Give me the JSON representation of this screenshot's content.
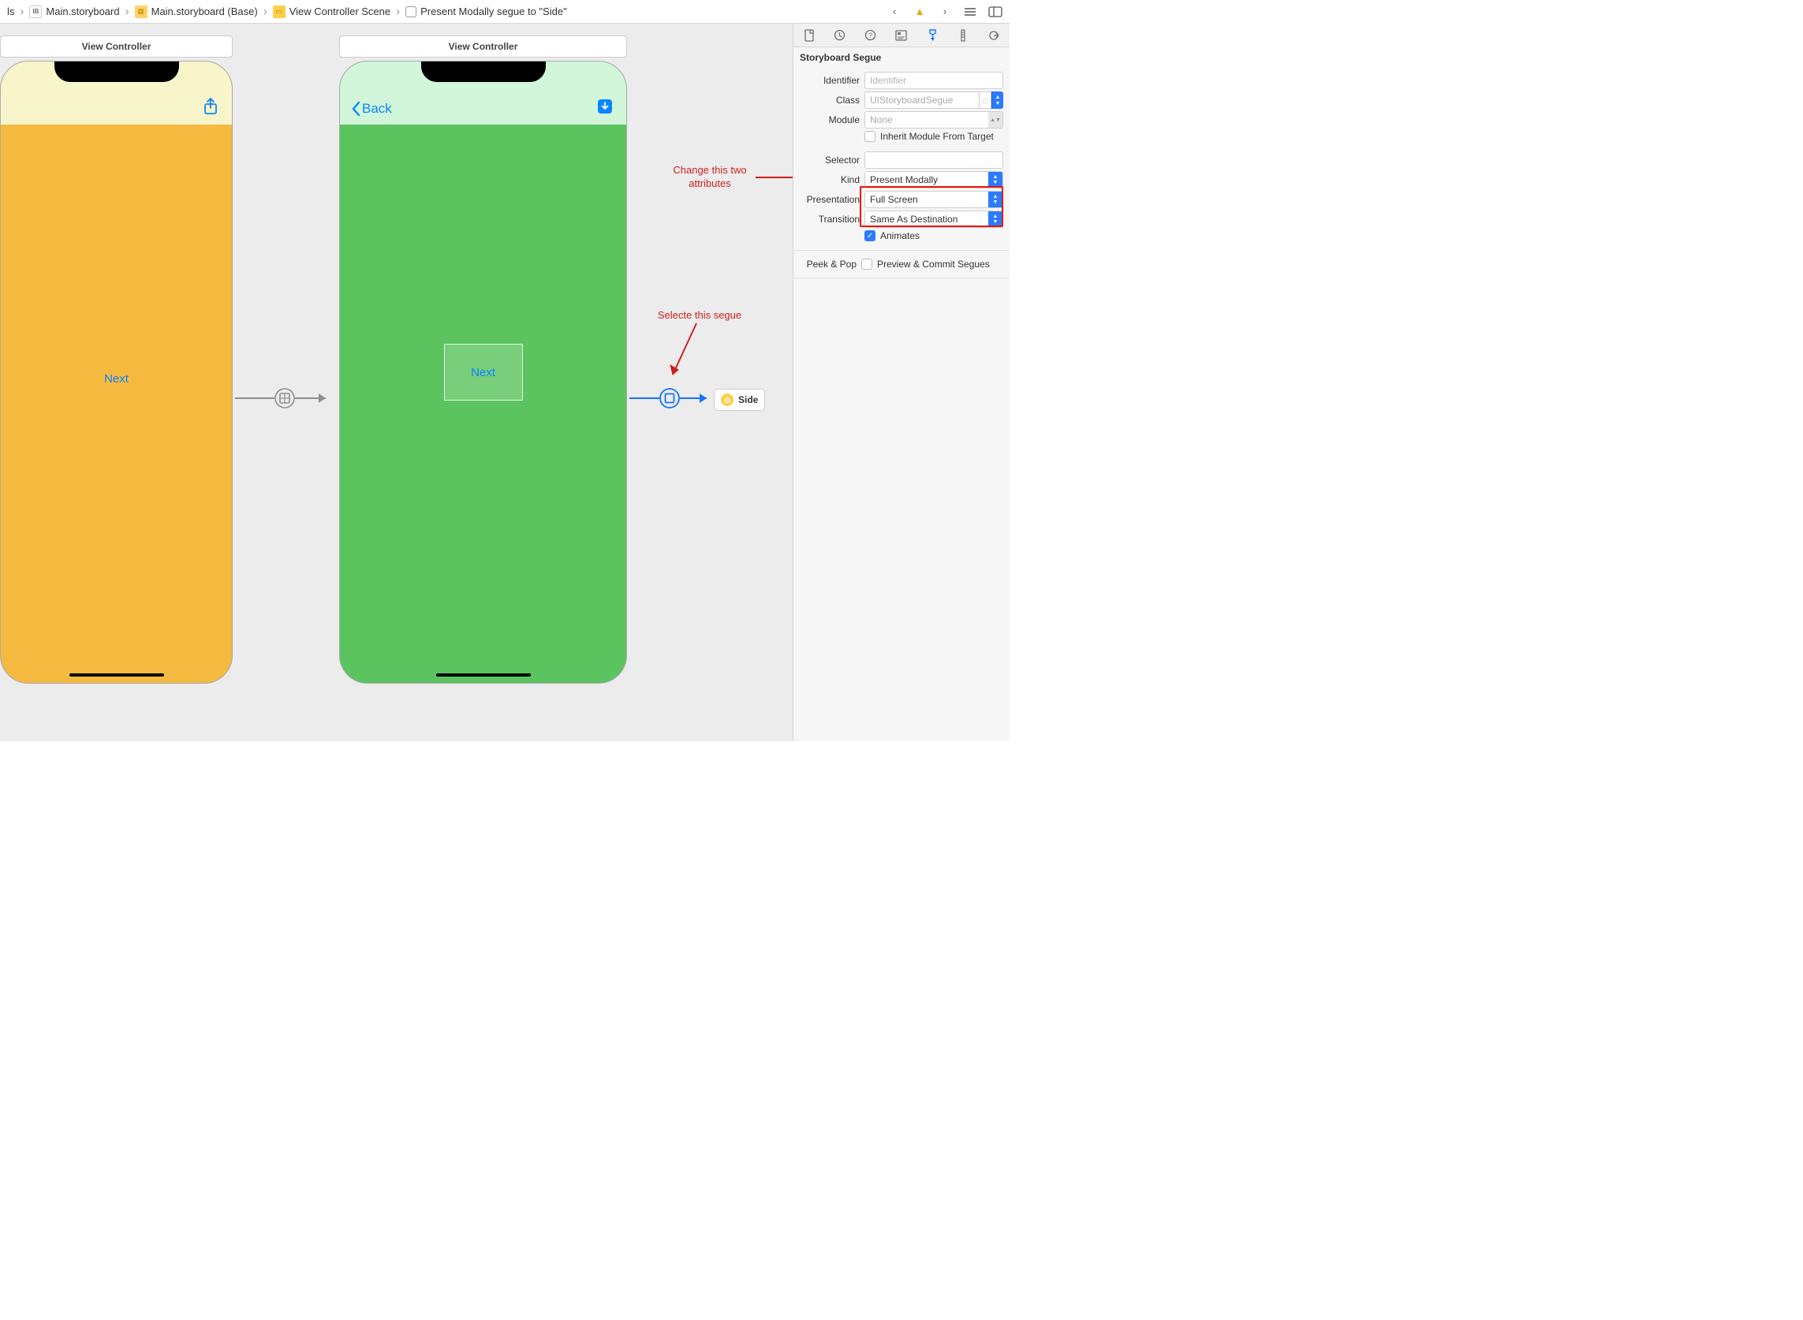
{
  "jumpbar": {
    "crumbs": [
      {
        "icon": "txt",
        "label": "ls"
      },
      {
        "icon": "file",
        "label": "Main.storyboard"
      },
      {
        "icon": "sb",
        "label": "Main.storyboard (Base)"
      },
      {
        "icon": "scene",
        "label": "View Controller Scene"
      },
      {
        "icon": "segue",
        "label": "Present Modally segue to \"Side\""
      }
    ]
  },
  "canvas": {
    "vc1": {
      "title": "View Controller",
      "button": "Next"
    },
    "vc2": {
      "title": "View Controller",
      "back": "Back",
      "button": "Next"
    },
    "ref": {
      "label": "Side"
    }
  },
  "annotations": {
    "attrs": "Change this two\nattributes",
    "segue": "Selecte this segue"
  },
  "inspector": {
    "section": "Storyboard Segue",
    "identifier": {
      "label": "Identifier",
      "placeholder": "Identifier",
      "value": ""
    },
    "class": {
      "label": "Class",
      "value": "UIStoryboardSegue"
    },
    "module": {
      "label": "Module",
      "value": "None"
    },
    "inherit": {
      "label": "Inherit Module From Target",
      "checked": false
    },
    "selector": {
      "label": "Selector",
      "value": ""
    },
    "kind": {
      "label": "Kind",
      "value": "Present Modally"
    },
    "presentation": {
      "label": "Presentation",
      "value": "Full Screen"
    },
    "transition": {
      "label": "Transition",
      "value": "Same As Destination"
    },
    "animates": {
      "label": "Animates",
      "checked": true
    },
    "peek": {
      "label": "Peek & Pop",
      "option": "Preview & Commit Segues",
      "checked": false
    }
  }
}
